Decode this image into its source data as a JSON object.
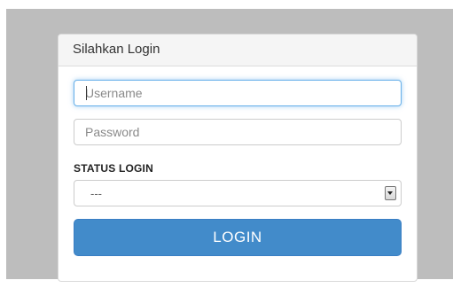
{
  "panel": {
    "title": "Silahkan Login"
  },
  "form": {
    "username_placeholder": "Username",
    "username_value": "",
    "password_placeholder": "Password",
    "password_value": "",
    "status_label": "STATUS LOGIN",
    "status_select": {
      "selected": "---",
      "arrow_icon": "chevron-down-icon"
    },
    "submit_label": "LOGIN"
  },
  "colors": {
    "background": "#bdbdbd",
    "panel_heading": "#f5f5f5",
    "primary_button": "#428bca",
    "focus_border": "#66afe9"
  }
}
